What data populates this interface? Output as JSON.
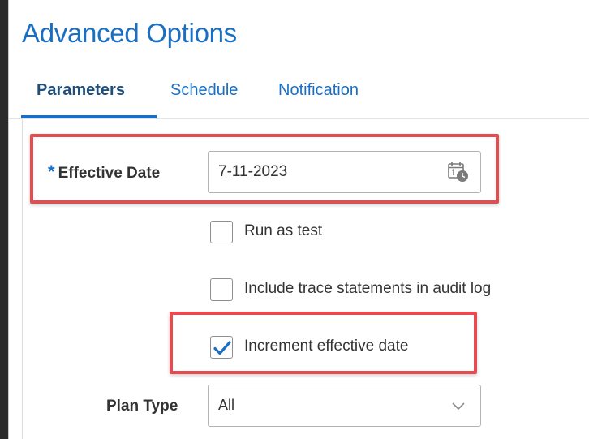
{
  "header": {
    "title": "Advanced Options"
  },
  "tabs": [
    {
      "label": "Parameters",
      "active": true
    },
    {
      "label": "Schedule",
      "active": false
    },
    {
      "label": "Notification",
      "active": false
    }
  ],
  "form": {
    "effective_date": {
      "required_marker": "*",
      "label": "Effective Date",
      "value": "7-11-2023",
      "icon": "calendar-icon"
    },
    "options": [
      {
        "label": "Run as test",
        "checked": false
      },
      {
        "label": "Include trace statements in audit log",
        "checked": false
      },
      {
        "label": "Increment effective date",
        "checked": true
      }
    ],
    "plan_type": {
      "label": "Plan Type",
      "value": "All",
      "icon": "chevron-down-icon"
    }
  },
  "colors": {
    "accent": "#1b6fc2",
    "highlight": "#e84b4f",
    "background": "#2b2b2b"
  }
}
